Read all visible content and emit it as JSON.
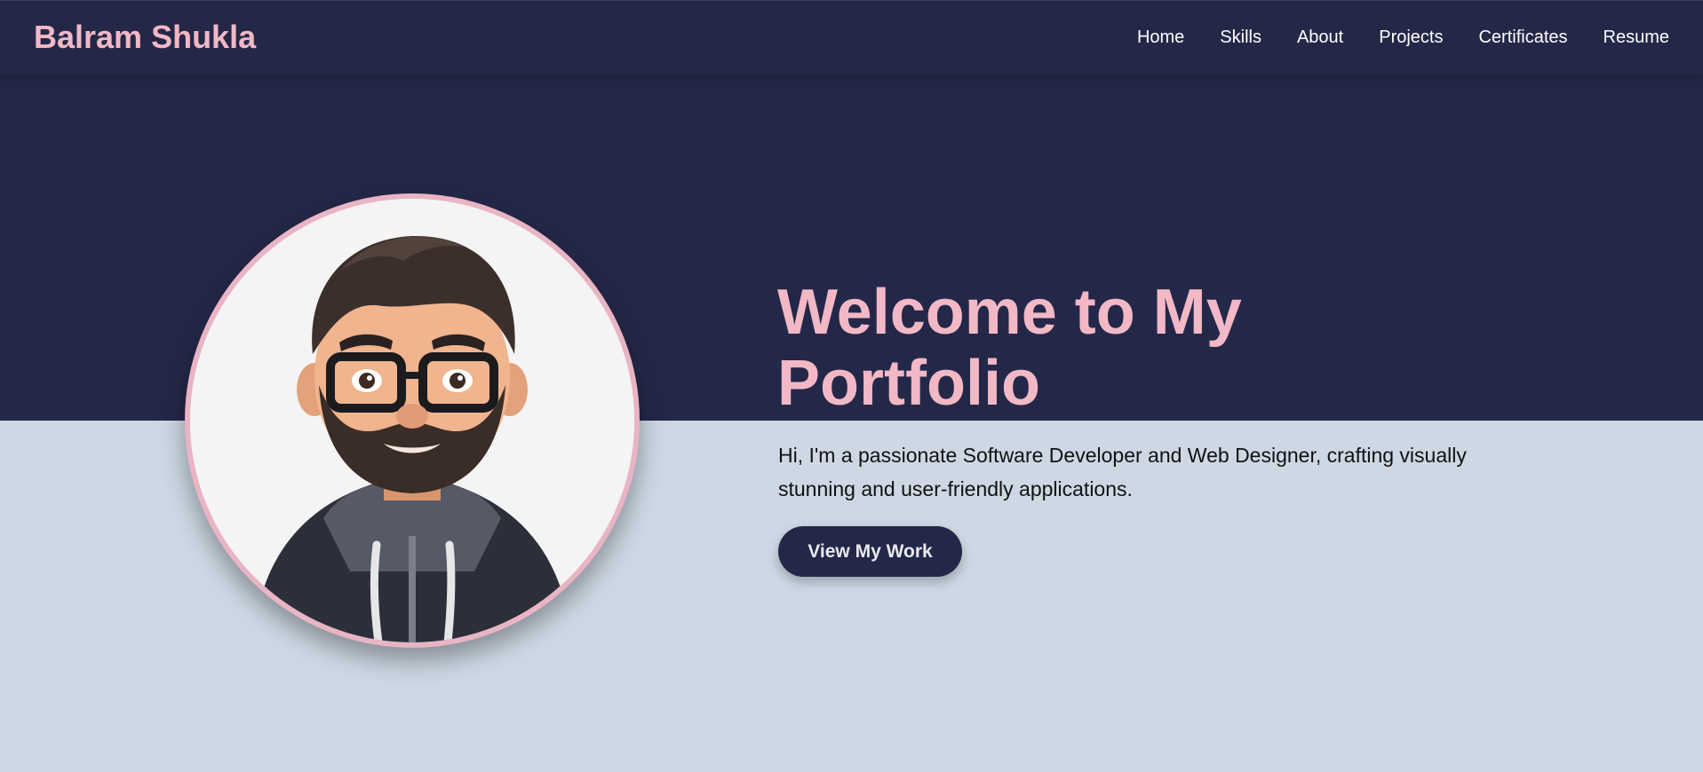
{
  "header": {
    "brand": "Balram Shukla",
    "nav": [
      "Home",
      "Skills",
      "About",
      "Projects",
      "Certificates",
      "Resume"
    ]
  },
  "hero": {
    "title": "Welcome to My Portfolio",
    "text": "Hi, I'm a passionate Software Developer and Web Designer, crafting visually stunning and user-friendly applications.",
    "cta_label": "View My Work",
    "avatar_icon": "cartoon-avatar-man-glasses-beard"
  },
  "colors": {
    "navy": "#242848",
    "pink": "#f2b8c6",
    "light_bg": "#cdd8e4"
  }
}
